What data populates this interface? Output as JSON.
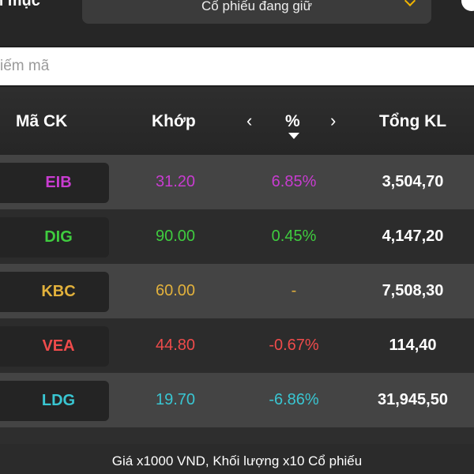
{
  "topbar": {
    "title": "n mục",
    "dropdown_value": "Cổ phiếu đang giữ"
  },
  "search": {
    "placeholder": "iếm mã"
  },
  "table": {
    "headers": {
      "symbol": "Mã CK",
      "price": "Khớp",
      "prev": "‹",
      "pct": "%",
      "next": "›",
      "volume": "Tổng KL"
    },
    "sort": "descending",
    "rows": [
      {
        "symbol": "EIB",
        "price": "31.20",
        "pct": "6.85%",
        "volume": "3,504,70",
        "color": "#c83cd0"
      },
      {
        "symbol": "DIG",
        "price": "90.00",
        "pct": "0.45%",
        "volume": "4,147,20",
        "color": "#3fcc3f"
      },
      {
        "symbol": "KBC",
        "price": "60.00",
        "pct": "-",
        "volume": "7,508,30",
        "color": "#e2b13c"
      },
      {
        "symbol": "VEA",
        "price": "44.80",
        "pct": "-0.67%",
        "volume": "114,40",
        "color": "#ef4b4b"
      },
      {
        "symbol": "LDG",
        "price": "19.70",
        "pct": "-6.86%",
        "volume": "31,945,50",
        "color": "#39c6d2"
      }
    ]
  },
  "footer": {
    "note": "Giá x1000 VND, Khối lượng x10 Cổ phiếu"
  },
  "colors": {
    "accent": "#f0b400",
    "ceiling": "#c83cd0",
    "up": "#3fcc3f",
    "reference": "#e2b13c",
    "down": "#ef4b4b",
    "floor": "#39c6d2"
  }
}
